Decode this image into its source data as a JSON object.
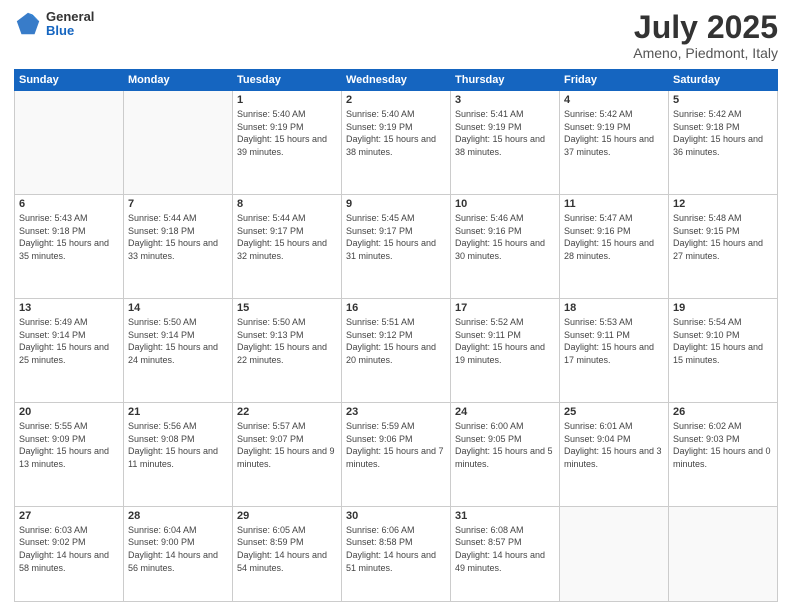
{
  "header": {
    "logo": {
      "general": "General",
      "blue": "Blue"
    },
    "title": "July 2025",
    "location": "Ameno, Piedmont, Italy"
  },
  "days_header": [
    "Sunday",
    "Monday",
    "Tuesday",
    "Wednesday",
    "Thursday",
    "Friday",
    "Saturday"
  ],
  "weeks": [
    [
      {
        "num": "",
        "info": ""
      },
      {
        "num": "",
        "info": ""
      },
      {
        "num": "1",
        "info": "Sunrise: 5:40 AM\nSunset: 9:19 PM\nDaylight: 15 hours\nand 39 minutes."
      },
      {
        "num": "2",
        "info": "Sunrise: 5:40 AM\nSunset: 9:19 PM\nDaylight: 15 hours\nand 38 minutes."
      },
      {
        "num": "3",
        "info": "Sunrise: 5:41 AM\nSunset: 9:19 PM\nDaylight: 15 hours\nand 38 minutes."
      },
      {
        "num": "4",
        "info": "Sunrise: 5:42 AM\nSunset: 9:19 PM\nDaylight: 15 hours\nand 37 minutes."
      },
      {
        "num": "5",
        "info": "Sunrise: 5:42 AM\nSunset: 9:18 PM\nDaylight: 15 hours\nand 36 minutes."
      }
    ],
    [
      {
        "num": "6",
        "info": "Sunrise: 5:43 AM\nSunset: 9:18 PM\nDaylight: 15 hours\nand 35 minutes."
      },
      {
        "num": "7",
        "info": "Sunrise: 5:44 AM\nSunset: 9:18 PM\nDaylight: 15 hours\nand 33 minutes."
      },
      {
        "num": "8",
        "info": "Sunrise: 5:44 AM\nSunset: 9:17 PM\nDaylight: 15 hours\nand 32 minutes."
      },
      {
        "num": "9",
        "info": "Sunrise: 5:45 AM\nSunset: 9:17 PM\nDaylight: 15 hours\nand 31 minutes."
      },
      {
        "num": "10",
        "info": "Sunrise: 5:46 AM\nSunset: 9:16 PM\nDaylight: 15 hours\nand 30 minutes."
      },
      {
        "num": "11",
        "info": "Sunrise: 5:47 AM\nSunset: 9:16 PM\nDaylight: 15 hours\nand 28 minutes."
      },
      {
        "num": "12",
        "info": "Sunrise: 5:48 AM\nSunset: 9:15 PM\nDaylight: 15 hours\nand 27 minutes."
      }
    ],
    [
      {
        "num": "13",
        "info": "Sunrise: 5:49 AM\nSunset: 9:14 PM\nDaylight: 15 hours\nand 25 minutes."
      },
      {
        "num": "14",
        "info": "Sunrise: 5:50 AM\nSunset: 9:14 PM\nDaylight: 15 hours\nand 24 minutes."
      },
      {
        "num": "15",
        "info": "Sunrise: 5:50 AM\nSunset: 9:13 PM\nDaylight: 15 hours\nand 22 minutes."
      },
      {
        "num": "16",
        "info": "Sunrise: 5:51 AM\nSunset: 9:12 PM\nDaylight: 15 hours\nand 20 minutes."
      },
      {
        "num": "17",
        "info": "Sunrise: 5:52 AM\nSunset: 9:11 PM\nDaylight: 15 hours\nand 19 minutes."
      },
      {
        "num": "18",
        "info": "Sunrise: 5:53 AM\nSunset: 9:11 PM\nDaylight: 15 hours\nand 17 minutes."
      },
      {
        "num": "19",
        "info": "Sunrise: 5:54 AM\nSunset: 9:10 PM\nDaylight: 15 hours\nand 15 minutes."
      }
    ],
    [
      {
        "num": "20",
        "info": "Sunrise: 5:55 AM\nSunset: 9:09 PM\nDaylight: 15 hours\nand 13 minutes."
      },
      {
        "num": "21",
        "info": "Sunrise: 5:56 AM\nSunset: 9:08 PM\nDaylight: 15 hours\nand 11 minutes."
      },
      {
        "num": "22",
        "info": "Sunrise: 5:57 AM\nSunset: 9:07 PM\nDaylight: 15 hours\nand 9 minutes."
      },
      {
        "num": "23",
        "info": "Sunrise: 5:59 AM\nSunset: 9:06 PM\nDaylight: 15 hours\nand 7 minutes."
      },
      {
        "num": "24",
        "info": "Sunrise: 6:00 AM\nSunset: 9:05 PM\nDaylight: 15 hours\nand 5 minutes."
      },
      {
        "num": "25",
        "info": "Sunrise: 6:01 AM\nSunset: 9:04 PM\nDaylight: 15 hours\nand 3 minutes."
      },
      {
        "num": "26",
        "info": "Sunrise: 6:02 AM\nSunset: 9:03 PM\nDaylight: 15 hours\nand 0 minutes."
      }
    ],
    [
      {
        "num": "27",
        "info": "Sunrise: 6:03 AM\nSunset: 9:02 PM\nDaylight: 14 hours\nand 58 minutes."
      },
      {
        "num": "28",
        "info": "Sunrise: 6:04 AM\nSunset: 9:00 PM\nDaylight: 14 hours\nand 56 minutes."
      },
      {
        "num": "29",
        "info": "Sunrise: 6:05 AM\nSunset: 8:59 PM\nDaylight: 14 hours\nand 54 minutes."
      },
      {
        "num": "30",
        "info": "Sunrise: 6:06 AM\nSunset: 8:58 PM\nDaylight: 14 hours\nand 51 minutes."
      },
      {
        "num": "31",
        "info": "Sunrise: 6:08 AM\nSunset: 8:57 PM\nDaylight: 14 hours\nand 49 minutes."
      },
      {
        "num": "",
        "info": ""
      },
      {
        "num": "",
        "info": ""
      }
    ]
  ]
}
